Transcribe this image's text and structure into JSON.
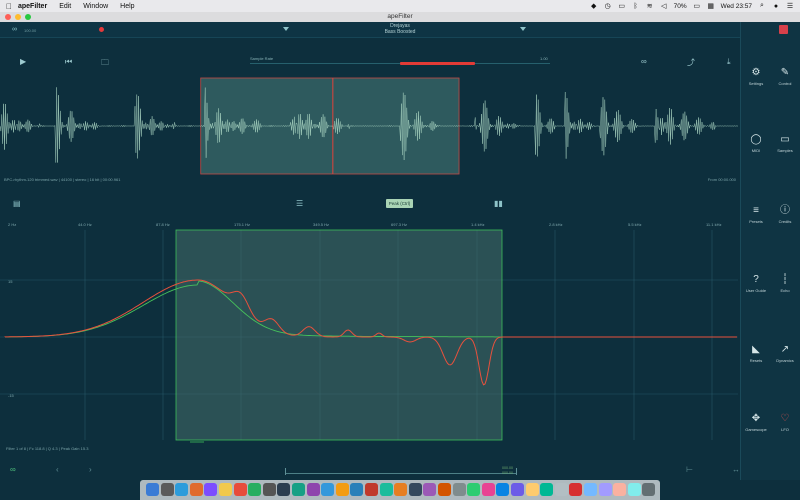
{
  "menubar": {
    "app_name": "apeFilter",
    "menus": [
      "Edit",
      "Window",
      "Help"
    ],
    "battery": "70%",
    "clock": "Wed 23:57"
  },
  "window": {
    "title": "apeFilter"
  },
  "topbar": {
    "value_label": "100.00",
    "preset_line1": "Drejayas",
    "preset_line2": "Bass Boosted"
  },
  "transport": {
    "sample_rate_label": "Sample Rate",
    "sample_rate_value": "1.00",
    "sample_rate_fraction": 0.5
  },
  "waveform": {
    "file_info": "BPC-rhythm-120 trimmed.wav | 44100 | stereo | 16 bit | 00:00.961",
    "from_info": "From 00:00.000",
    "selection_start": 0.272,
    "selection_end": 0.622,
    "playhead": 0.451
  },
  "midbar": {
    "peak_button": "Peak (Ctrl)"
  },
  "eq": {
    "freq_labels": [
      "2 Hz",
      "44.0 Hz",
      "87.8 Hz",
      "175.1 Hz",
      "349.5 Hz",
      "697.3 Hz",
      "1.4 kHz",
      "2.8 kHz",
      "5.5 kHz",
      "11.1 kHz"
    ],
    "db_top": "15",
    "db_bottom": "-15",
    "filter_info": "Filter 1 of 8 | Fc 118.8 | Q 4.3 | Peak Gain 15.3"
  },
  "bottombar": {
    "scroll_val_top": "000.00",
    "scroll_val_bottom": "000.00"
  },
  "right_panel": {
    "items": [
      {
        "label": "Settings",
        "icon": "gear-icon"
      },
      {
        "label": "Control",
        "icon": "wrench-icon"
      },
      {
        "label": "MIDI",
        "icon": "midi-icon"
      },
      {
        "label": "Samples",
        "icon": "folder-icon"
      },
      {
        "label": "Presets",
        "icon": "list-icon"
      },
      {
        "label": "Credits",
        "icon": "info-icon"
      },
      {
        "label": "User Guide",
        "icon": "help-icon"
      },
      {
        "label": "Echo",
        "icon": "echo-icon"
      },
      {
        "label": "Resets",
        "icon": "reset-icon"
      },
      {
        "label": "Dynamics",
        "icon": "dynamics-icon"
      },
      {
        "label": "Gamescope",
        "icon": "crosshair-icon"
      },
      {
        "label": "LFO",
        "icon": "heart-icon"
      }
    ]
  },
  "colors": {
    "background": "#0d2f3d",
    "accent_red": "#e23b36",
    "accent_green": "#4fc27d",
    "wave": "#b6e2cd",
    "selection": "#2e5a5e"
  }
}
